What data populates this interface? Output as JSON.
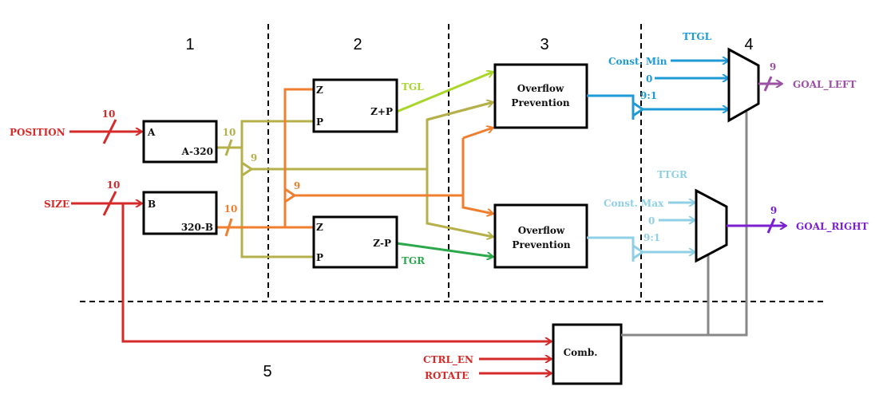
{
  "sections": [
    "1",
    "2",
    "3",
    "4",
    "5"
  ],
  "inputs": {
    "position": "POSITION",
    "size": "SIZE",
    "ctrl_en": "CTRL_EN",
    "rotate": "ROTATE",
    "position_width": "10",
    "size_width": "10"
  },
  "blocks": {
    "sub_a": {
      "in": "A",
      "out": "A-320",
      "out_width": "10"
    },
    "sub_b": {
      "in": "B",
      "out": "320-B",
      "out_width": "10"
    },
    "split_gold": "9",
    "split_orange": "9",
    "adder": {
      "z": "Z",
      "p": "P",
      "out": "Z+P",
      "signal": "TGL"
    },
    "subtractor": {
      "z": "Z",
      "p": "P",
      "out": "Z-P",
      "signal": "TGR"
    },
    "overflow1": [
      "Overflow",
      "Prevention"
    ],
    "overflow2": [
      "Overflow",
      "Prevention"
    ],
    "comb": "Comb."
  },
  "mux_left": {
    "title": "TTGL",
    "inputs": [
      "Const. Min",
      "0",
      "9:1"
    ],
    "out_width": "9",
    "output": "GOAL_LEFT"
  },
  "mux_right": {
    "title": "TTGR",
    "inputs": [
      "Const. Max",
      "0",
      "9:1"
    ],
    "out_width": "9",
    "output": "GOAL_RIGHT"
  },
  "colors": {
    "red": "#d62a2a",
    "gold": "#b5b04a",
    "orange": "#ef7f2f",
    "lime": "#a8d62a",
    "green": "#2aa84a",
    "blue": "#1e9ad6",
    "lightblue": "#8fd0e6",
    "purple_left": "#9b4fa5",
    "purple_right": "#7b1fd0",
    "gray": "#888888"
  }
}
